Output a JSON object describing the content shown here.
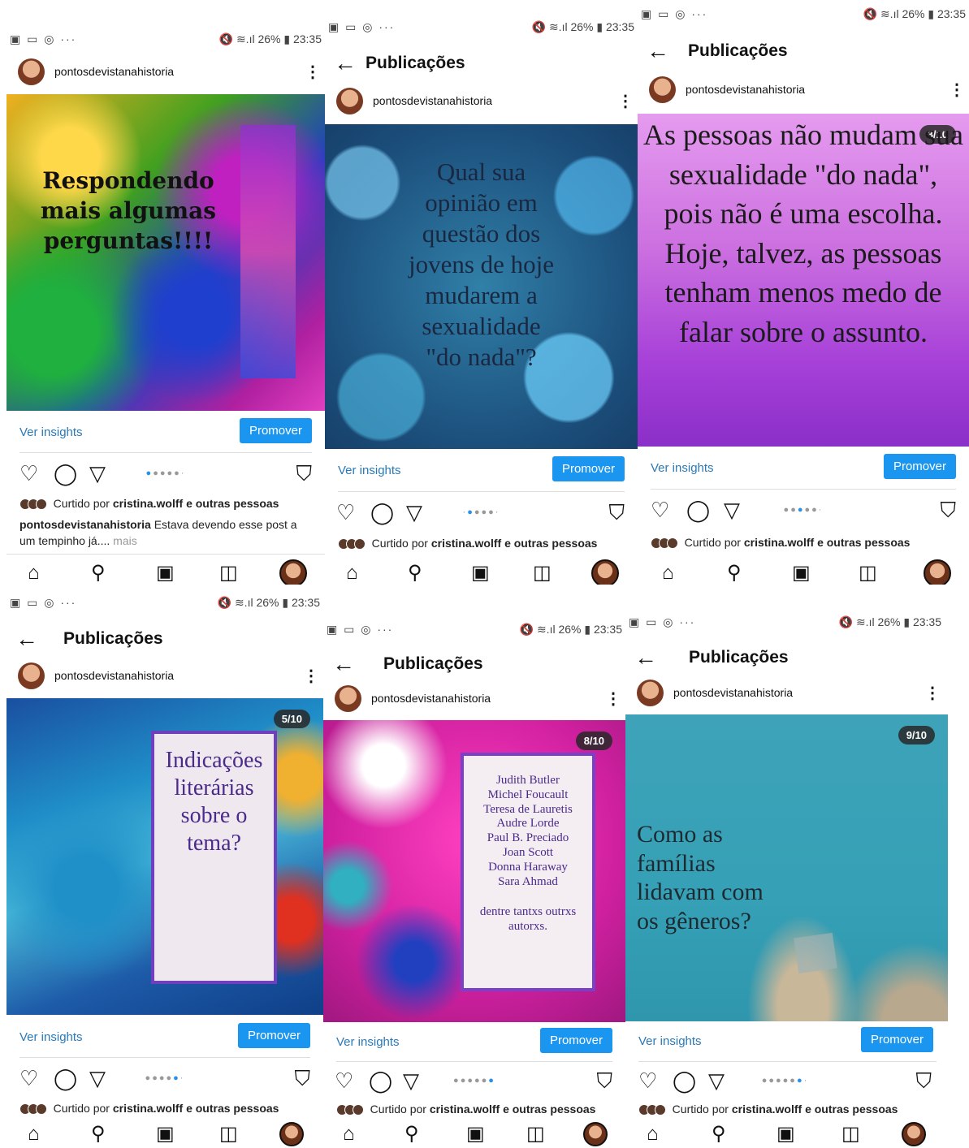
{
  "status": {
    "left_icons": "▣ ▭ ◎ ···",
    "right": "🔇 ≋.ıl 26% ▮ 23:35"
  },
  "header_title": "Publicações",
  "username": "pontosdevistanahistoria",
  "insights_label": "Ver insights",
  "promote_label": "Promover",
  "liked_prefix": "Curtido por ",
  "liked_user": "cristina.wolff",
  "liked_suffix": " e outras pessoas",
  "panels": [
    {
      "slide_text": "Respondendo mais algumas perguntas!!!!",
      "caption_user": "pontosdevistanahistoria",
      "caption_text": " Estava devendo esse post a um tempinho já....",
      "caption_more": " mais"
    },
    {
      "slide_text": "Qual sua opinião em questão dos jovens de hoje mudarem a sexualidade \"do nada\"?"
    },
    {
      "counter": "3/10",
      "slide_text": "As pessoas não mudam sua sexualidade \"do nada\", pois não é uma escolha. Hoje, talvez, as pessoas tenham menos medo de falar sobre o assunto."
    },
    {
      "counter": "5/10",
      "slide_text": "Indicações literárias sobre o tema?"
    },
    {
      "counter": "8/10",
      "authors": [
        "Judith Butler",
        "Michel Foucault",
        "Teresa de Lauretis",
        "Audre Lorde",
        "Paul B. Preciado",
        "Joan Scott",
        "Donna Haraway",
        "Sara Ahmad"
      ],
      "footer": "dentre tantxs outrxs autorxs."
    },
    {
      "counter": "9/10",
      "slide_text": "Como as famílias lidavam com os gêneros?"
    }
  ],
  "icons": {
    "back": "arrow-left",
    "like": "heart",
    "comment": "speech-bubble",
    "share": "paper-plane",
    "save": "bookmark",
    "home": "home",
    "search": "search",
    "reels": "reels",
    "shop": "shopping-bag"
  }
}
